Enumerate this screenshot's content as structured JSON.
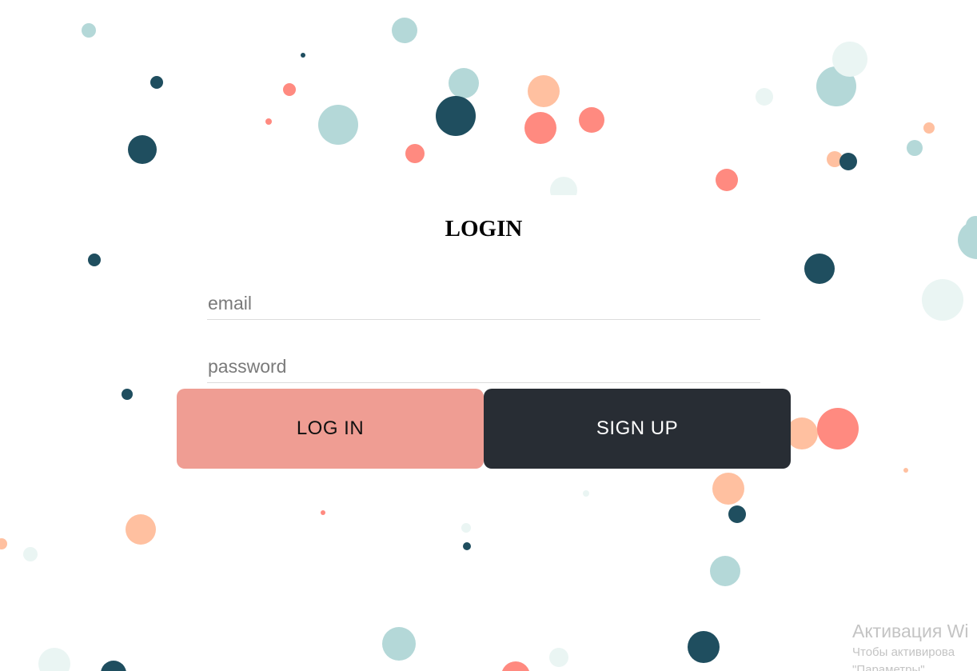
{
  "login_form": {
    "title": "LOGIN",
    "email_placeholder": "email",
    "password_placeholder": "password",
    "login_label": "LOG IN",
    "signup_label": "SIGN UP"
  },
  "windows_watermark": {
    "title": "Активация Wi",
    "line1": "Чтобы активирова",
    "line2": "\"Параметры\"."
  },
  "colors": {
    "background": "#ffffff",
    "login_button": "#ef9d93",
    "signup_button": "#282d34",
    "bubble_dark": "#1f4e5f",
    "bubble_light_teal": "#b4d8d8",
    "bubble_pale": "#eaf5f3",
    "bubble_coral": "#ff8a80",
    "bubble_peach": "#ffc0a0"
  }
}
